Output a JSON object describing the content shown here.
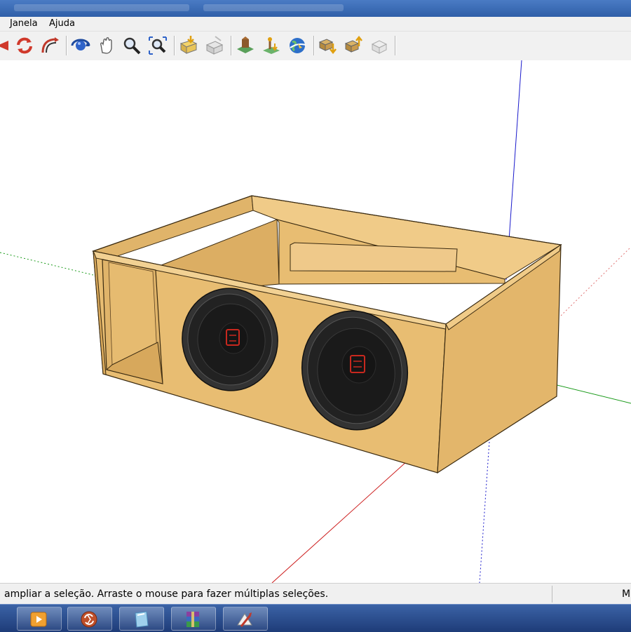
{
  "menubar": {
    "items": [
      {
        "label": "Janela"
      },
      {
        "label": "Ajuda"
      }
    ]
  },
  "toolbar": {
    "buttons": [
      {
        "icon": "previous-view-icon"
      },
      {
        "icon": "refresh-icon"
      },
      {
        "icon": "redo-camera-icon"
      },
      {
        "icon": "orbit-icon"
      },
      {
        "icon": "pan-hand-icon"
      },
      {
        "icon": "zoom-icon"
      },
      {
        "icon": "zoom-extents-icon"
      },
      {
        "icon": "get-models-icon"
      },
      {
        "icon": "share-model-icon"
      },
      {
        "icon": "add-location-icon"
      },
      {
        "icon": "toggle-terrain-icon"
      },
      {
        "icon": "google-earth-icon"
      },
      {
        "icon": "get-components-icon"
      },
      {
        "icon": "share-component-icon"
      },
      {
        "icon": "extension-warehouse-icon"
      }
    ]
  },
  "viewport": {
    "model": "speaker-box",
    "colors": {
      "wood": "#e8bd72",
      "wood_dark": "#d9a95c",
      "wood_light": "#f0cb88",
      "speaker_ring": "#333333",
      "speaker_cone": "#1a1a1a",
      "logo": "#c8281e",
      "axis_blue": "#1a1acc",
      "axis_red": "#cc1a1a",
      "axis_green": "#1a9a1a"
    }
  },
  "status": {
    "text": "ampliar a seleção. Arraste o mouse para fazer múltiplas seleções.",
    "right": "M"
  },
  "taskbar": {
    "apps": [
      {
        "icon": "media-player-icon"
      },
      {
        "icon": "sync-app-icon"
      },
      {
        "icon": "glass-window-icon"
      },
      {
        "icon": "winrar-icon"
      },
      {
        "icon": "sketchup-icon"
      }
    ]
  }
}
